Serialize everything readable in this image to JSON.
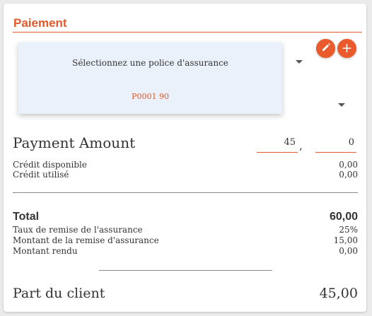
{
  "section": {
    "title": "Paiement"
  },
  "icons": {
    "edit": "pencil-icon",
    "add": "plus-icon",
    "dropdown": "caret-down-icon"
  },
  "colors": {
    "accent": "#e5582a",
    "dropdown_bg": "#eaf1fa"
  },
  "dropdown": {
    "header": "Sélectionnez une police d'assurance",
    "options": [
      "P0001 90"
    ]
  },
  "payment": {
    "label": "Payment Amount",
    "integer": "45",
    "separator": ",",
    "decimal": "0"
  },
  "credit": {
    "available_label": "Crédit disponible",
    "available_value": "0,00",
    "used_label": "Crédit utilisé",
    "used_value": "0,00"
  },
  "summary": {
    "total_label": "Total",
    "total_value": "60,00",
    "discount_rate_label": "Taux de remise de l'assurance",
    "discount_rate_value": "25%",
    "discount_amount_label": "Montant de la remise d'assurance",
    "discount_amount_value": "15,00",
    "change_label": "Montant rendu",
    "change_value": "0,00"
  },
  "client_share": {
    "label": "Part du client",
    "value": "45,00"
  }
}
